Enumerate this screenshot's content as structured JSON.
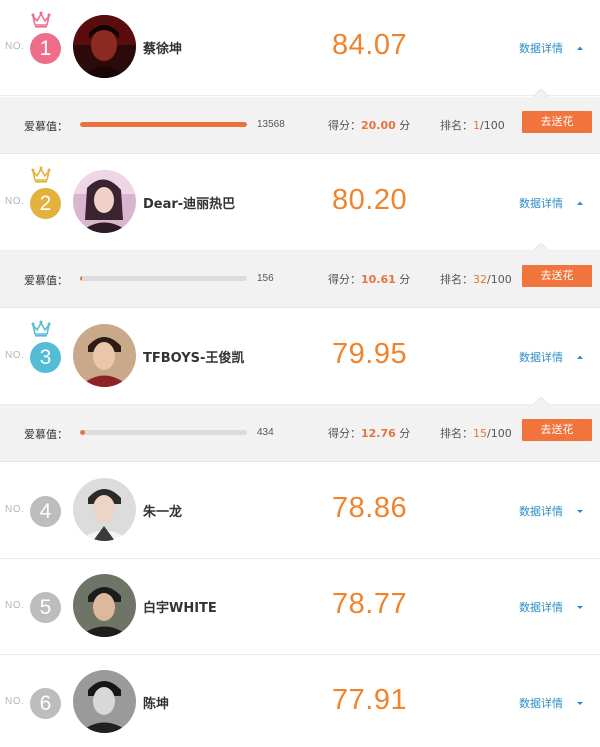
{
  "labels": {
    "no_prefix": "NO.",
    "detail_link": "数据详情",
    "love_label": "爱慕值：",
    "score_label": "得分：",
    "score_unit": "分",
    "rank_label": "排名：",
    "rank_total": "/100",
    "send_button": "去送花"
  },
  "colors": {
    "accent": "#f0832c",
    "button": "#f0743b",
    "link": "#2f8dc5",
    "rank1": "#ee6e8a",
    "rank2": "#e2b23c",
    "rank3": "#55bcd6",
    "rank_other": "#bdbdbd",
    "crown1": "#ee6e8a",
    "crown2": "#e2b23c",
    "crown3": "#55bcd6"
  },
  "ranking": [
    {
      "rank": "1",
      "name": "蔡徐坤",
      "score": "84.07",
      "expanded": true,
      "arrow": "caret-up-icon",
      "detail": {
        "love_value": "13568",
        "love_fraction": 1.0,
        "points": "20.00",
        "position": "1"
      }
    },
    {
      "rank": "2",
      "name": "Dear-迪丽热巴",
      "score": "80.20",
      "expanded": true,
      "arrow": "caret-up-icon",
      "detail": {
        "love_value": "156",
        "love_fraction": 0.0115,
        "points": "10.61",
        "position": "32"
      }
    },
    {
      "rank": "3",
      "name": "TFBOYS-王俊凯",
      "score": "79.95",
      "expanded": true,
      "arrow": "caret-up-icon",
      "detail": {
        "love_value": "434",
        "love_fraction": 0.032,
        "points": "12.76",
        "position": "15"
      }
    },
    {
      "rank": "4",
      "name": "朱一龙",
      "score": "78.86",
      "expanded": false,
      "arrow": "caret-down-icon"
    },
    {
      "rank": "5",
      "name": "白宇WHITE",
      "score": "78.77",
      "expanded": false,
      "arrow": "caret-down-icon"
    },
    {
      "rank": "6",
      "name": "陈坤",
      "score": "77.91",
      "expanded": false,
      "arrow": "caret-down-icon"
    }
  ]
}
